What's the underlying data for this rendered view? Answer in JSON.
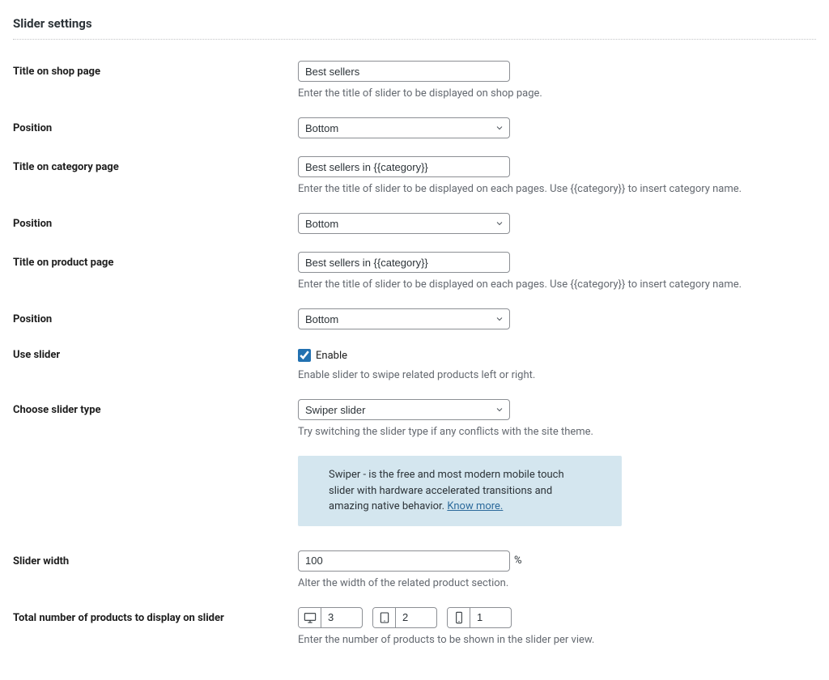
{
  "section_title": "Slider settings",
  "labels": {
    "title_shop": "Title on shop page",
    "position1": "Position",
    "title_category": "Title on category page",
    "position2": "Position",
    "title_product": "Title on product page",
    "position3": "Position",
    "use_slider": "Use slider",
    "slider_type": "Choose slider type",
    "slider_width": "Slider width",
    "total_products": "Total number of products to display on slider"
  },
  "values": {
    "title_shop": "Best sellers",
    "position1": "Bottom",
    "title_category": "Best sellers in {{category}}",
    "position2": "Bottom",
    "title_product": "Best sellers in {{category}}",
    "position3": "Bottom",
    "use_slider_enable": "Enable",
    "slider_type": "Swiper slider",
    "slider_width": "100",
    "slider_width_unit": "%",
    "devices": {
      "desktop": "3",
      "tablet": "2",
      "mobile": "1"
    }
  },
  "descriptions": {
    "title_shop": "Enter the title of slider to be displayed on shop page.",
    "title_category": "Enter the title of slider to be displayed on each pages. Use {{category}} to insert category name.",
    "title_product": "Enter the title of slider to be displayed on each pages. Use {{category}} to insert category name.",
    "use_slider": "Enable slider to swipe related products left or right.",
    "slider_type": "Try switching the slider type if any conflicts with the site theme.",
    "slider_width": "Alter the width of the related product section.",
    "total_products": "Enter the number of products to be shown in the slider per view."
  },
  "notice": {
    "text": "Swiper - is the free and most modern mobile touch slider with hardware accelerated transitions and amazing native behavior. ",
    "link": "Know more."
  }
}
